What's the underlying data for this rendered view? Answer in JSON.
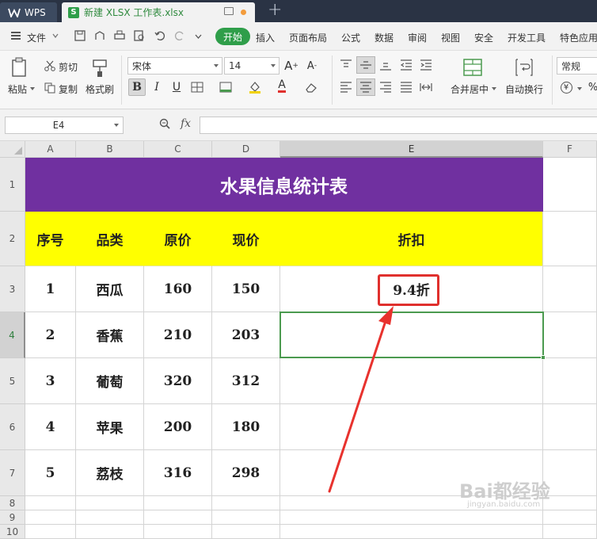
{
  "app": {
    "brand": "WPS",
    "file_tab": "新建 XLSX 工作表.xlsx",
    "new_tab_symbol": "+"
  },
  "menu": {
    "file": "文件",
    "items": [
      "开始",
      "插入",
      "页面布局",
      "公式",
      "数据",
      "审阅",
      "视图",
      "安全",
      "开发工具",
      "特色应用"
    ]
  },
  "ribbon": {
    "paste": "粘贴",
    "cut": "剪切",
    "copy": "复制",
    "format_painter": "格式刷",
    "font_name": "宋体",
    "font_size": "14",
    "grow_font": "A",
    "shrink_font": "A",
    "bold": "B",
    "italic": "I",
    "underline": "U",
    "font_color_glyph": "A",
    "merge_center": "合并居中",
    "wrap_text": "自动换行",
    "number_format": "常规",
    "currency_glyph": "¥",
    "percent_glyph": "%"
  },
  "formula_bar": {
    "cell_ref": "E4",
    "fx": "fx",
    "content": ""
  },
  "sheet": {
    "columns": [
      "A",
      "B",
      "C",
      "D",
      "E",
      "F"
    ],
    "rows": [
      "1",
      "2",
      "3",
      "4",
      "5",
      "6",
      "7",
      "8",
      "9",
      "10"
    ],
    "selected_cell": "E4",
    "title": "水果信息统计表",
    "headers": [
      "序号",
      "品类",
      "原价",
      "现价",
      "折扣"
    ],
    "data": [
      [
        "1",
        "西瓜",
        "160",
        "150",
        "9.4折"
      ],
      [
        "2",
        "香蕉",
        "210",
        "203",
        ""
      ],
      [
        "3",
        "葡萄",
        "320",
        "312",
        ""
      ],
      [
        "4",
        "苹果",
        "200",
        "180",
        ""
      ],
      [
        "5",
        "荔枝",
        "316",
        "298",
        ""
      ]
    ]
  },
  "colors": {
    "title_fill": "#7030a0",
    "header_fill": "#ffff00",
    "accent_green": "#2f9e4a",
    "annotation_red": "#e0302d"
  },
  "watermark": {
    "main": "Bai都经验",
    "sub": "jingyan.baidu.com"
  }
}
